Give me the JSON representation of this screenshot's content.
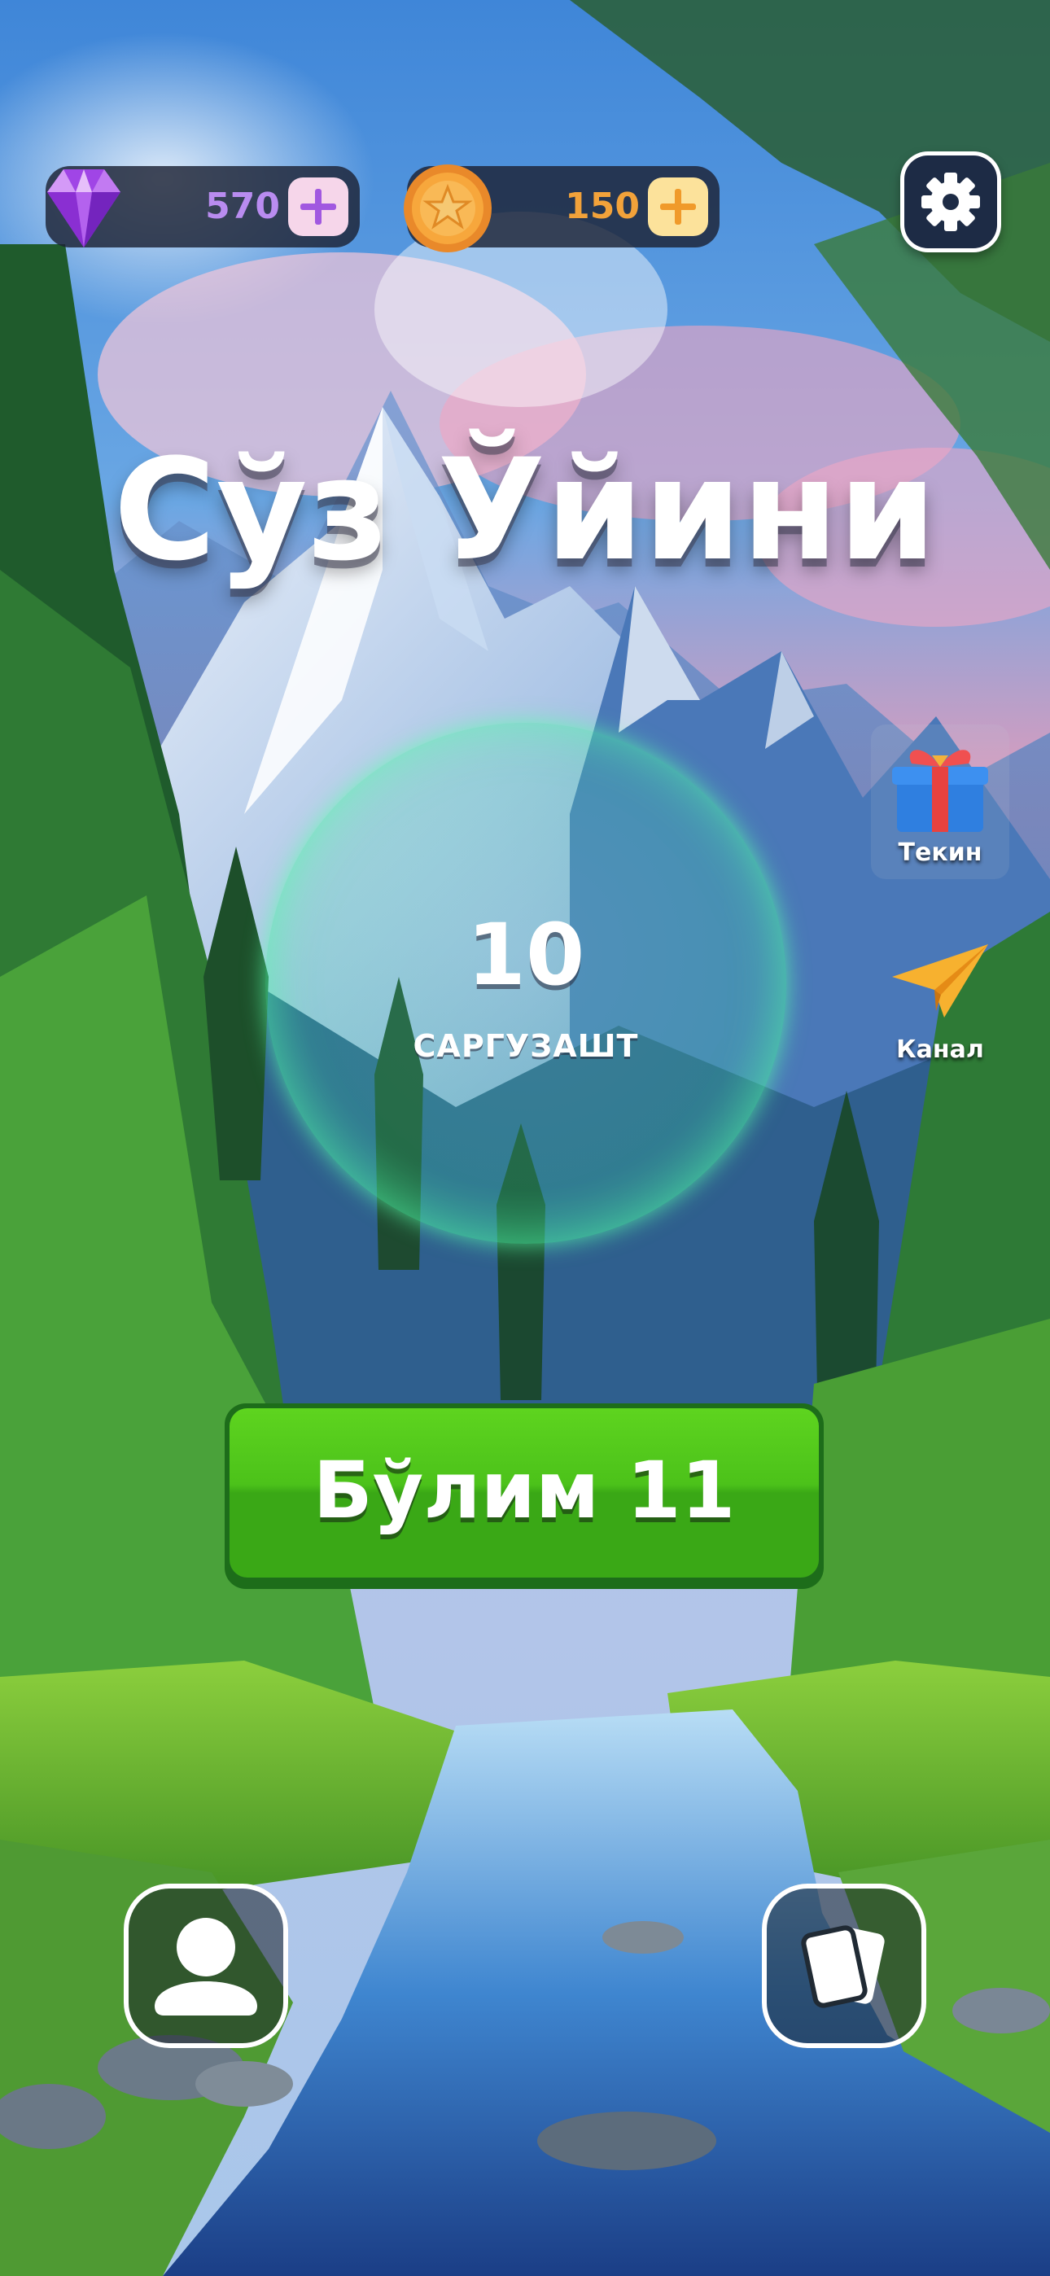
{
  "currencies": {
    "gems": {
      "value": "570",
      "icon": "gem-icon",
      "color": "#b98cf0"
    },
    "coins": {
      "value": "150",
      "icon": "coin-icon",
      "color": "#f2a23a"
    }
  },
  "header": {
    "settings_icon": "gear-icon"
  },
  "title": "Сўз Ўйини",
  "adventure": {
    "count": "10",
    "label": "САРГУЗАШТ"
  },
  "side_menu": [
    {
      "id": "gift",
      "label": "Текин",
      "icon": "gift-icon"
    },
    {
      "id": "channel",
      "label": "Канал",
      "icon": "paper-plane-icon"
    }
  ],
  "play_button": {
    "label": "Бўлим 11",
    "color": "#4cc21a"
  },
  "bottom_bar": {
    "profile_icon": "user-icon",
    "cards_icon": "cards-icon"
  }
}
